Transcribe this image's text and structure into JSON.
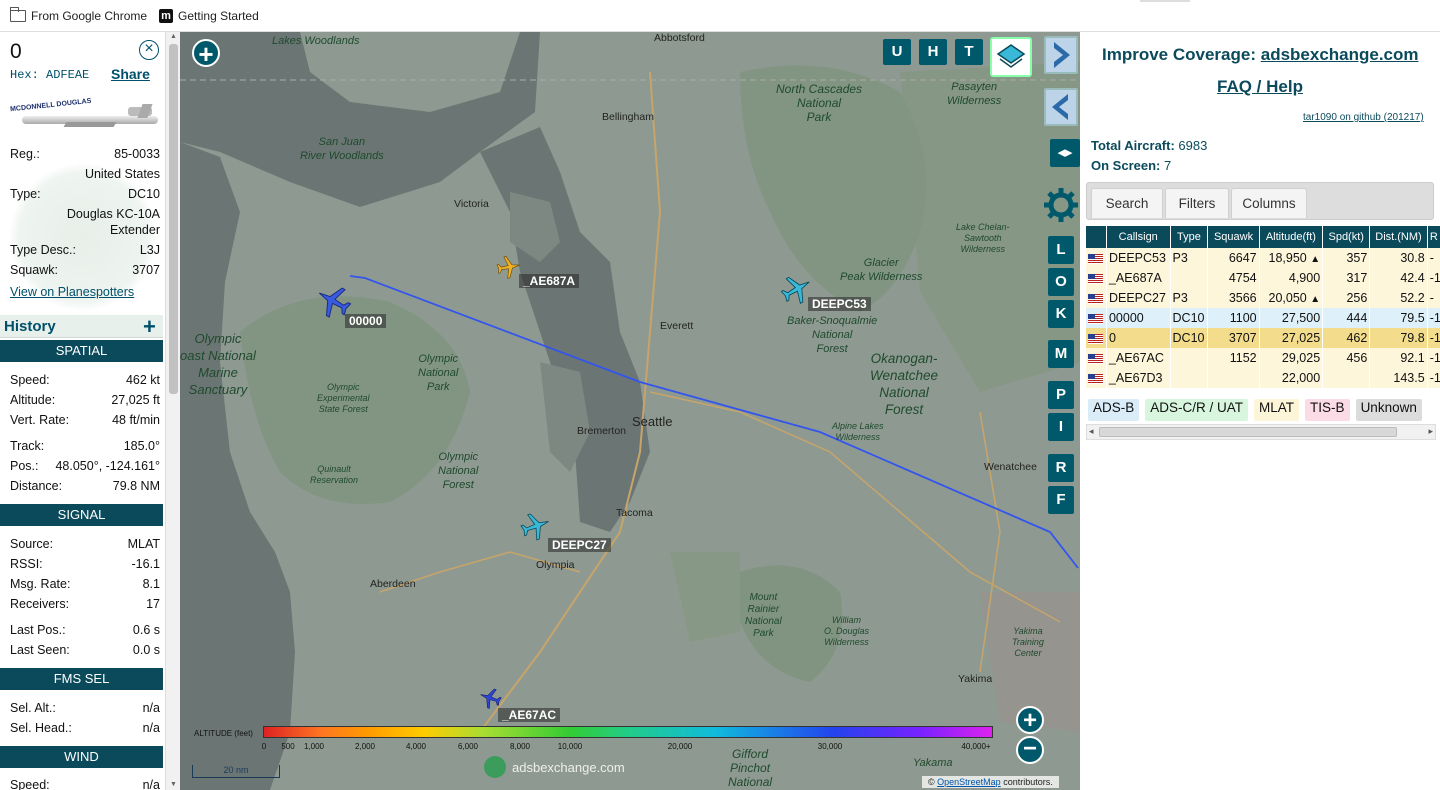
{
  "bookmarks": [
    {
      "label": "From Google Chrome",
      "icon": "folder-icon"
    },
    {
      "label": "Getting Started",
      "icon": "m-logo-icon"
    }
  ],
  "aircraft": {
    "callsign": "0",
    "hex_label": "Hex:",
    "hex": "ADFEAE",
    "share": "Share",
    "reg_label": "Reg.:",
    "reg": "85-0033",
    "country": "United States",
    "type_label": "Type:",
    "type": "DC10",
    "type_name_1": "Douglas KC-10A",
    "type_name_2": "Extender",
    "typedesc_label": "Type Desc.:",
    "typedesc": "L3J",
    "squawk_label": "Squawk:",
    "squawk": "3707",
    "planespotters": "View on Planespotters",
    "photo_brand": "MCDONNELL DOUGLAS"
  },
  "history": {
    "title": "History",
    "add": "+"
  },
  "spatial": {
    "title": "SPATIAL",
    "speed_label": "Speed:",
    "speed": "462 kt",
    "alt_label": "Altitude:",
    "alt": "27,025 ft",
    "vrate_label": "Vert. Rate:",
    "vrate": "48 ft/min",
    "track_label": "Track:",
    "track": "185.0°",
    "pos_label": "Pos.:",
    "pos": "48.050°, -124.161°",
    "dist_label": "Distance:",
    "dist": "79.8 NM"
  },
  "signal": {
    "title": "SIGNAL",
    "source_label": "Source:",
    "source": "MLAT",
    "rssi_label": "RSSI:",
    "rssi": "-16.1",
    "msg_label": "Msg. Rate:",
    "msg": "8.1",
    "recv_label": "Receivers:",
    "recv": "17",
    "lastpos_label": "Last Pos.:",
    "lastpos": "0.6 s",
    "lastseen_label": "Last Seen:",
    "lastseen": "0.0 s"
  },
  "fms": {
    "title": "FMS SEL",
    "alt_label": "Sel. Alt.:",
    "alt": "n/a",
    "head_label": "Sel. Head.:",
    "head": "n/a"
  },
  "wind": {
    "title": "WIND",
    "speed_label": "Speed:",
    "speed": "n/a"
  },
  "map": {
    "buttons": {
      "u": "U",
      "h": "H",
      "t": "T",
      "l": "L",
      "o": "O",
      "k": "K",
      "m": "M",
      "p": "P",
      "i": "I",
      "r": "R",
      "f": "F"
    },
    "zoom_in": "+",
    "zoom_out": "−",
    "planes": [
      {
        "label": "00000"
      },
      {
        "label": "_AE687A"
      },
      {
        "label": "DEEPC53"
      },
      {
        "label": "DEEPC27"
      },
      {
        "label": "_AE67AC"
      }
    ],
    "park_labels": [
      {
        "text": "Lakes Woodlands"
      },
      {
        "text": "San Juan\nRiver Woodlands"
      },
      {
        "text": "North Cascades\nNational\nPark"
      },
      {
        "text": "Pasayten\nWilderness"
      },
      {
        "text": "Lake Chelan-\nSawtooth\nWilderness"
      },
      {
        "text": "Glacier\nPeak Wilderness"
      },
      {
        "text": "Olympic\noast National\nMarine\nSanctuary"
      },
      {
        "text": "Olympic\nNational\nPark"
      },
      {
        "text": "Olympic\nExperimental\nState Forest"
      },
      {
        "text": "Baker-Snoqualmie\nNational\nForest"
      },
      {
        "text": "Okanogan-\nWenatchee\nNational\nForest"
      },
      {
        "text": "Alpine Lakes\nWilderness"
      },
      {
        "text": "Quinault\nReservation"
      },
      {
        "text": "Olympic\nNational\nForest"
      },
      {
        "text": "Mount\nRainier\nNational\nPark"
      },
      {
        "text": "William\nO. Douglas\nWilderness"
      },
      {
        "text": "Yakima\nTraining\nCenter"
      },
      {
        "text": "Gifford\nPinchot\nNational"
      },
      {
        "text": "Yakama"
      }
    ],
    "cities": [
      {
        "text": "Abbotsford"
      },
      {
        "text": "Bellingham"
      },
      {
        "text": "Victoria"
      },
      {
        "text": "Everett"
      },
      {
        "text": "Seattle"
      },
      {
        "text": "Bremerton"
      },
      {
        "text": "Tacoma"
      },
      {
        "text": "Olympia"
      },
      {
        "text": "Aberdeen"
      },
      {
        "text": "Wenatchee"
      },
      {
        "text": "Yakima"
      }
    ],
    "alt_title": "ALTITUDE (feet)",
    "alt_ticks": [
      "0",
      "500",
      "1,000",
      "2,000",
      "4,000",
      "6,000",
      "8,000",
      "10,000",
      "20,000",
      "30,000",
      "40,000+"
    ],
    "scale": "20 nm",
    "brand": "adsbexchange.com",
    "attrib_prefix": "©",
    "attrib_link": "OpenStreetMap",
    "attrib_suffix": "contributors."
  },
  "right": {
    "coverage_prefix": "Improve Coverage:",
    "coverage_link": "adsbexchange.com",
    "faq": "FAQ / Help",
    "version": "tar1090 on github (201217)",
    "total_label": "Total Aircraft:",
    "total": "6983",
    "onscreen_label": "On Screen:",
    "onscreen": "7",
    "tabs": [
      "Search",
      "Filters",
      "Columns"
    ],
    "columns": [
      "Callsign",
      "Type",
      "Squawk",
      "Altitude(ft)",
      "Spd(kt)",
      "Dist.(NM)",
      "R"
    ],
    "rows": [
      {
        "callsign": "DEEPC53",
        "type": "P3",
        "squawk": "6647",
        "alt": "18,950",
        "arrow": "▲",
        "spd": "357",
        "dist": "30.8",
        "r": "-"
      },
      {
        "callsign": "_AE687A",
        "type": "",
        "squawk": "4754",
        "alt": "4,900",
        "arrow": "",
        "spd": "317",
        "dist": "42.4",
        "r": "-1"
      },
      {
        "callsign": "DEEPC27",
        "type": "P3",
        "squawk": "3566",
        "alt": "20,050",
        "arrow": "▲",
        "spd": "256",
        "dist": "52.2",
        "r": "-"
      },
      {
        "callsign": "00000",
        "type": "DC10",
        "squawk": "1100",
        "alt": "27,500",
        "arrow": "",
        "spd": "444",
        "dist": "79.5",
        "r": "-1"
      },
      {
        "callsign": "0",
        "type": "DC10",
        "squawk": "3707",
        "alt": "27,025",
        "arrow": "",
        "spd": "462",
        "dist": "79.8",
        "r": "-1"
      },
      {
        "callsign": "_AE67AC",
        "type": "",
        "squawk": "1152",
        "alt": "29,025",
        "arrow": "",
        "spd": "456",
        "dist": "92.1",
        "r": "-1"
      },
      {
        "callsign": "_AE67D3",
        "type": "",
        "squawk": "",
        "alt": "22,000",
        "arrow": "",
        "spd": "",
        "dist": "143.5",
        "r": "-1"
      }
    ],
    "legend": [
      {
        "label": "ADS-B",
        "bg": "#d9ecf8"
      },
      {
        "label": "ADS-C/R / UAT",
        "bg": "#d8f6dd"
      },
      {
        "label": "MLAT",
        "bg": "#fdf5d8"
      },
      {
        "label": "TIS-B",
        "bg": "#fbdbe6"
      },
      {
        "label": "Unknown",
        "bg": "#dcdcdc"
      }
    ]
  },
  "colors": {
    "accent": "#0b4a5b",
    "track": "#3355ee"
  }
}
